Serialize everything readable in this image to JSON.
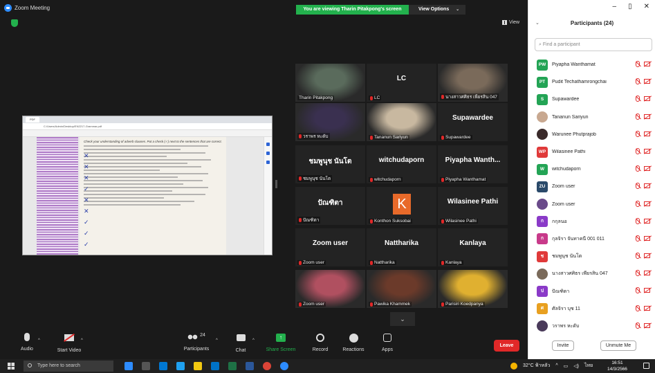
{
  "window": {
    "title": "Zoom Meeting",
    "viewing_banner": "You are viewing Tharin Pitakpong's screen",
    "view_options": "View Options",
    "view_button": "View"
  },
  "shared_screen": {
    "browser_url": "C:/Users/Admin/Desktop/EN2217-Grammar.pdf",
    "pdf_instruction": "Check your understanding of adverb clauses. Put a check (✓) next to the sentences that are correct."
  },
  "tiles": [
    {
      "label": "Tharin Pitakpong",
      "big": "",
      "photo": true,
      "active": true,
      "muted": false,
      "color": "#5a6b5c"
    },
    {
      "label": "LC",
      "big": "LC",
      "photo": false,
      "muted": true
    },
    {
      "label": "นางสาวศศิธร เพียรสิน 047",
      "big": "",
      "photo": true,
      "muted": true,
      "color": "#7a6a5a"
    },
    {
      "label": "วราพร หะดับ",
      "big": "",
      "photo": true,
      "muted": true,
      "color": "#3a3050"
    },
    {
      "label": "Tananun Sariyun",
      "big": "",
      "photo": true,
      "muted": true,
      "color": "#c8b8a0"
    },
    {
      "label": "Supawardee",
      "big": "Supawardee",
      "photo": false,
      "muted": true
    },
    {
      "label": "ชมพูนุช นันโต",
      "big": "ชมพูนุช นันโต",
      "photo": false,
      "muted": true
    },
    {
      "label": "witchudaporn",
      "big": "witchudaporn",
      "photo": false,
      "muted": true
    },
    {
      "label": "Piyapha Wanthamat",
      "big": "Piyapha Wanth...",
      "photo": false,
      "muted": true
    },
    {
      "label": "ปัณฑิตา",
      "big": "ปัณฑิตา",
      "photo": false,
      "muted": true
    },
    {
      "label": "Konthon Suksobai",
      "big": "",
      "photo": false,
      "k": "K",
      "muted": true
    },
    {
      "label": "Wilasinee Pathi",
      "big": "Wilasinee Pathi",
      "photo": false,
      "muted": true
    },
    {
      "label": "Zoom user",
      "big": "Zoom user",
      "photo": false,
      "muted": true
    },
    {
      "label": "Nattharika",
      "big": "Nattharika",
      "photo": false,
      "muted": true
    },
    {
      "label": "Kanlaya",
      "big": "Kanlaya",
      "photo": false,
      "muted": true
    },
    {
      "label": "Zoom user",
      "big": "",
      "photo": true,
      "muted": true,
      "color": "#b05060"
    },
    {
      "label": "Pawika Khammek",
      "big": "",
      "photo": true,
      "muted": true,
      "color": "#6b3a2a"
    },
    {
      "label": "Parisiri Koedpanya",
      "big": "",
      "photo": true,
      "muted": true,
      "color": "#e0b030"
    }
  ],
  "toolbar": {
    "audio": "Audio",
    "video": "Start Video",
    "participants": "Participants",
    "participants_count": "24",
    "chat": "Chat",
    "share": "Share Screen",
    "record": "Record",
    "reactions": "Reactions",
    "apps": "Apps",
    "leave": "Leave"
  },
  "panel": {
    "title": "Participants (24)",
    "search_placeholder": "Find a participant",
    "invite": "Invite",
    "unmute_me": "Unmute Me",
    "participants": [
      {
        "initials": "PW",
        "name": "Piyapha Wanthamat",
        "color": "#23a455"
      },
      {
        "initials": "PT",
        "name": "Pudit Techathamrongchai",
        "color": "#23a455"
      },
      {
        "initials": "S",
        "name": "Supawardee",
        "color": "#23a455"
      },
      {
        "initials": "",
        "name": "Tananun Sariyun",
        "color": "#c8a890",
        "photo": true
      },
      {
        "initials": "",
        "name": "Warunee Phutprajob",
        "color": "#3a2a2a",
        "photo": true
      },
      {
        "initials": "WP",
        "name": "Wilasinee Pathi",
        "color": "#e03a3a"
      },
      {
        "initials": "W",
        "name": "witchudaporn",
        "color": "#23a455"
      },
      {
        "initials": "ZU",
        "name": "Zoom user",
        "color": "#2a4a6a"
      },
      {
        "initials": "",
        "name": "Zoom user",
        "color": "#6a4a8a",
        "photo": true
      },
      {
        "initials": "ก",
        "name": "กกุลนอ",
        "color": "#8a3ac8"
      },
      {
        "initials": "ก",
        "name": "กุลจิรา จันทาคนี 001 011",
        "color": "#c83a8a"
      },
      {
        "initials": "ช",
        "name": "ชมพูนุช นันโต",
        "color": "#e03a3a"
      },
      {
        "initials": "",
        "name": "นางสาวศศิธร เพียรสิน 047",
        "color": "#7a6a5a",
        "photo": true
      },
      {
        "initials": "ป",
        "name": "ปัณฑิตา",
        "color": "#8a3ac8"
      },
      {
        "initials": "ศ",
        "name": "ศัลจิรา บุช 11",
        "color": "#e8a020"
      },
      {
        "initials": "",
        "name": "วราพร หะดับ",
        "color": "#4a3a5a",
        "photo": true
      }
    ]
  },
  "taskbar": {
    "search_placeholder": "Type here to search",
    "weather": "32°C ฟ้าหลัว",
    "lang": "ไทย",
    "time": "16:51",
    "date": "14/3/2566"
  }
}
